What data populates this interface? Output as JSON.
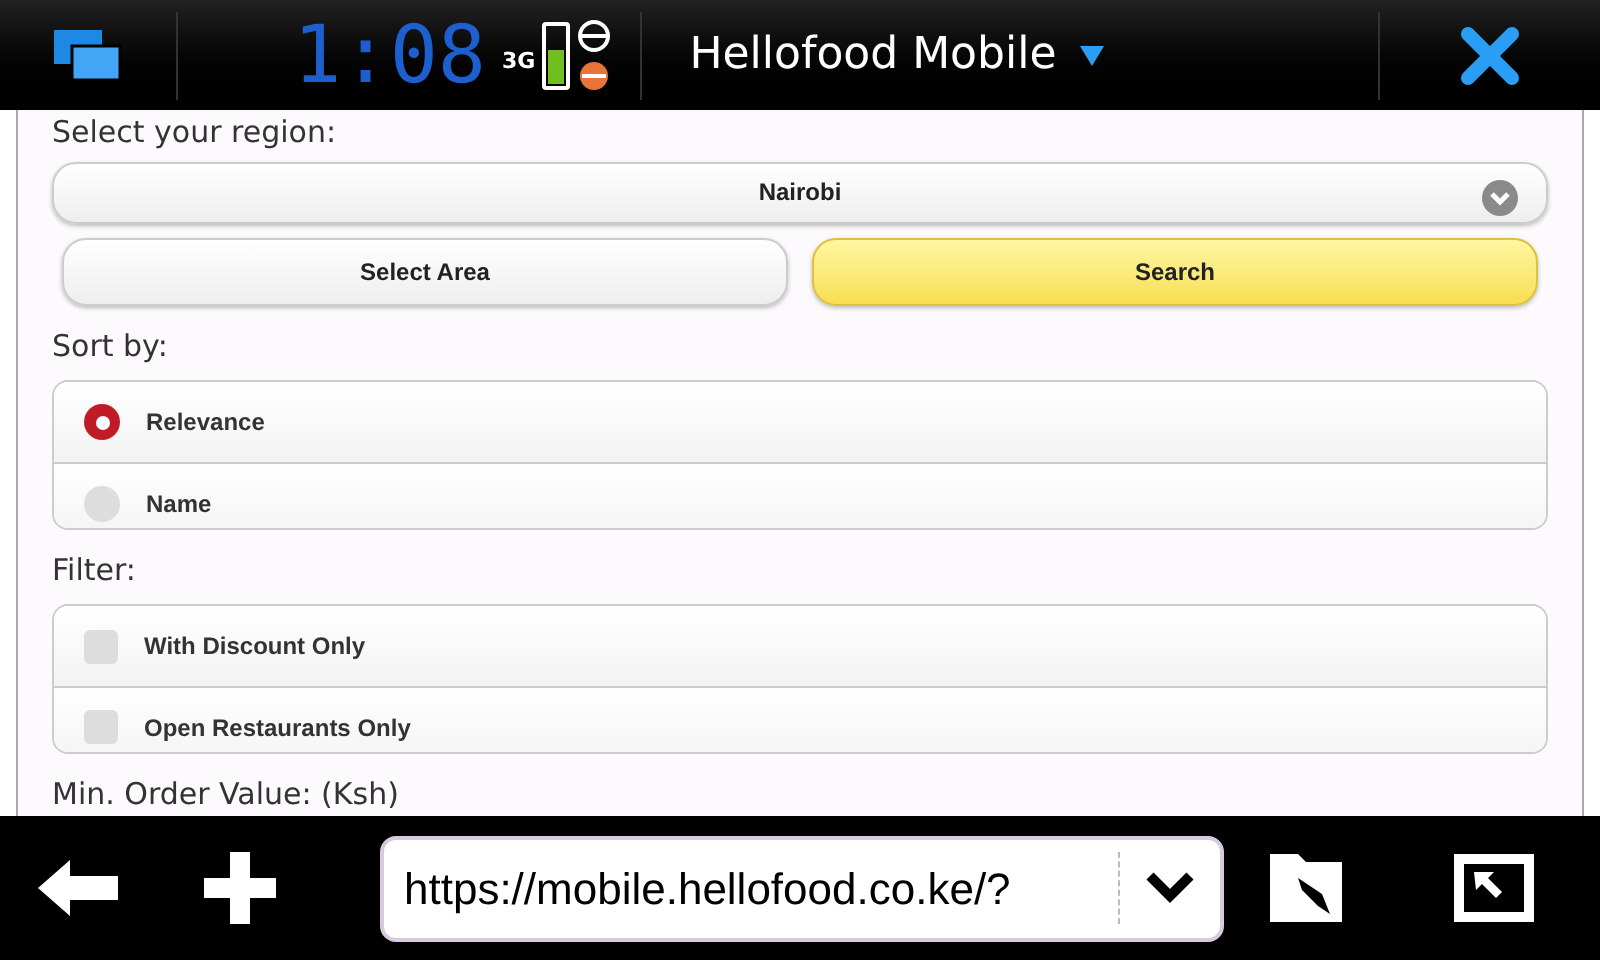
{
  "status_bar": {
    "time": "1:08",
    "network": "3G",
    "battery": {
      "level": 0.6
    },
    "title": "Hellofood Mobile"
  },
  "form": {
    "region_label": "Select your region:",
    "region_value": "Nairobi",
    "buttons": [
      {
        "label": "Select Area",
        "kind": "plain"
      },
      {
        "label": "Search",
        "kind": "primary"
      }
    ],
    "sort_label": "Sort by:",
    "sort_options": [
      {
        "label": "Relevance",
        "selected": true
      },
      {
        "label": "Name",
        "selected": false
      }
    ],
    "filter_label": "Filter:",
    "filters": [
      {
        "label": "With Discount Only",
        "checked": false
      },
      {
        "label": "Open Restaurants Only",
        "checked": false
      }
    ],
    "min_order_label": "Min. Order Value: (Ksh)"
  },
  "toolbar": {
    "url": "https://mobile.hellofood.co.ke/?"
  }
}
